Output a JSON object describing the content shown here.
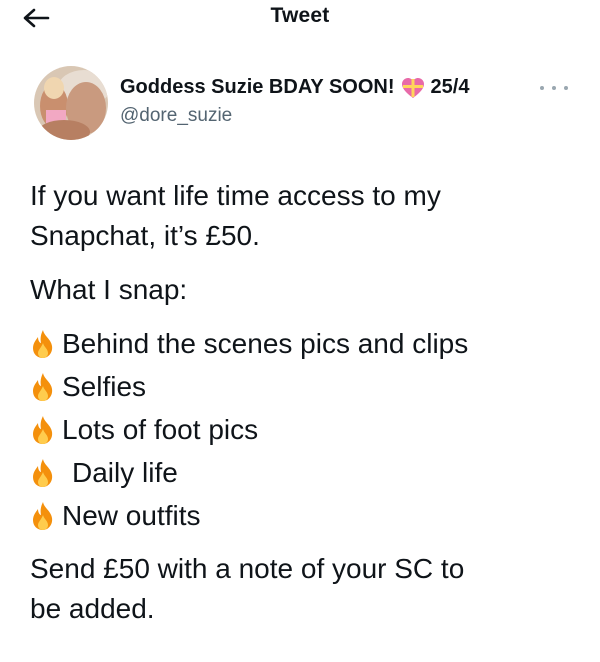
{
  "header": {
    "title": "Tweet",
    "back_icon": "arrow-left-icon"
  },
  "author": {
    "display_name": "Goddess Suzie BDAY SOON!",
    "emoji_icon": "heart-gift-emoji-icon",
    "name_suffix": "25/4",
    "handle": "@dore_suzie",
    "avatar": "avatar-photo"
  },
  "tweet": {
    "line1": "If you want life time access to my",
    "line2": "Snapchat, it’s £50.",
    "intro": "What I snap:",
    "items": [
      {
        "icon": "fire-emoji-icon",
        "text": "Behind the scenes pics and clips"
      },
      {
        "icon": "fire-emoji-icon",
        "text": "Selfies"
      },
      {
        "icon": "fire-emoji-icon",
        "text": "Lots of foot pics"
      },
      {
        "icon": "fire-emoji-icon",
        "text": "Daily life"
      },
      {
        "icon": "fire-emoji-icon",
        "text": "New outfits"
      }
    ],
    "closing1": "Send £50 with a note of your SC to",
    "closing2": "be added."
  },
  "colors": {
    "text": "#0f1419",
    "secondary": "#536471",
    "fire_outer": "#f4900c",
    "fire_inner": "#ffcc4d",
    "heart": "#e86aa8"
  }
}
